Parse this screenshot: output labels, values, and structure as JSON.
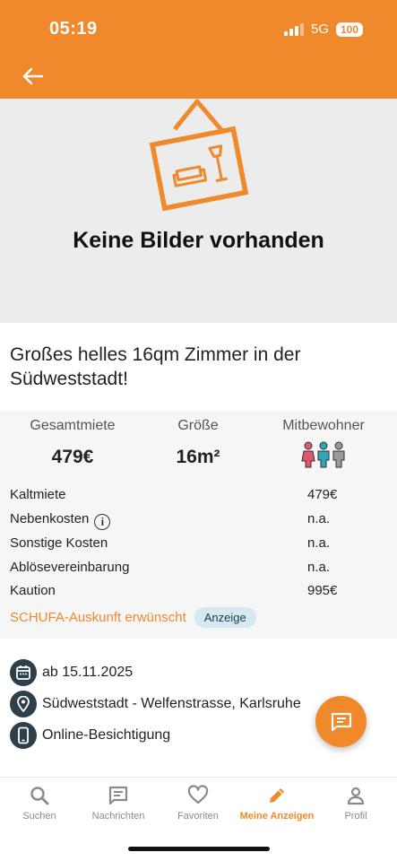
{
  "status_bar": {
    "time": "05:19",
    "network": "5G",
    "battery": "100"
  },
  "hero": {
    "no_images_text": "Keine Bilder vorhanden"
  },
  "listing": {
    "title": "Großes helles 16qm Zimmer in der Südweststadt!"
  },
  "stats": [
    {
      "label": "Gesamtmiete",
      "value": "479€"
    },
    {
      "label": "Größe",
      "value": "16m²"
    },
    {
      "label": "Mitbewohner"
    }
  ],
  "flatmates_icon_colors": [
    "#e0566b",
    "#2fa6b8",
    "#9a9a9a"
  ],
  "costs": [
    {
      "label": "Kaltmiete",
      "value": "479€"
    },
    {
      "label": "Nebenkosten",
      "value": "n.a."
    },
    {
      "label": "Sonstige Kosten",
      "value": "n.a."
    },
    {
      "label": "Ablösevereinbarung",
      "value": "n.a."
    },
    {
      "label": "Kaution",
      "value": "995€"
    }
  ],
  "schufa": {
    "text": "SCHUFA-Auskunft erwünscht",
    "badge": "Anzeige"
  },
  "details": [
    {
      "icon": "calendar-icon",
      "text": "ab 15.11.2025"
    },
    {
      "icon": "location-pin-icon",
      "text": "Südweststadt - Welfenstrasse, Karlsruhe"
    },
    {
      "icon": "phone-icon",
      "text": "Online-Besichtigung"
    }
  ],
  "tabs": [
    {
      "label": "Suchen",
      "icon": "search-icon"
    },
    {
      "label": "Nachrichten",
      "icon": "message-icon"
    },
    {
      "label": "Favoriten",
      "icon": "heart-icon"
    },
    {
      "label": "Meine Anzeigen",
      "icon": "pencil-icon",
      "active": true
    },
    {
      "label": "Profil",
      "icon": "person-icon"
    }
  ],
  "colors": {
    "brand": "#f0892b",
    "dark_icon_bg": "#2e3f49",
    "badge_bg": "#d6e8f2"
  }
}
